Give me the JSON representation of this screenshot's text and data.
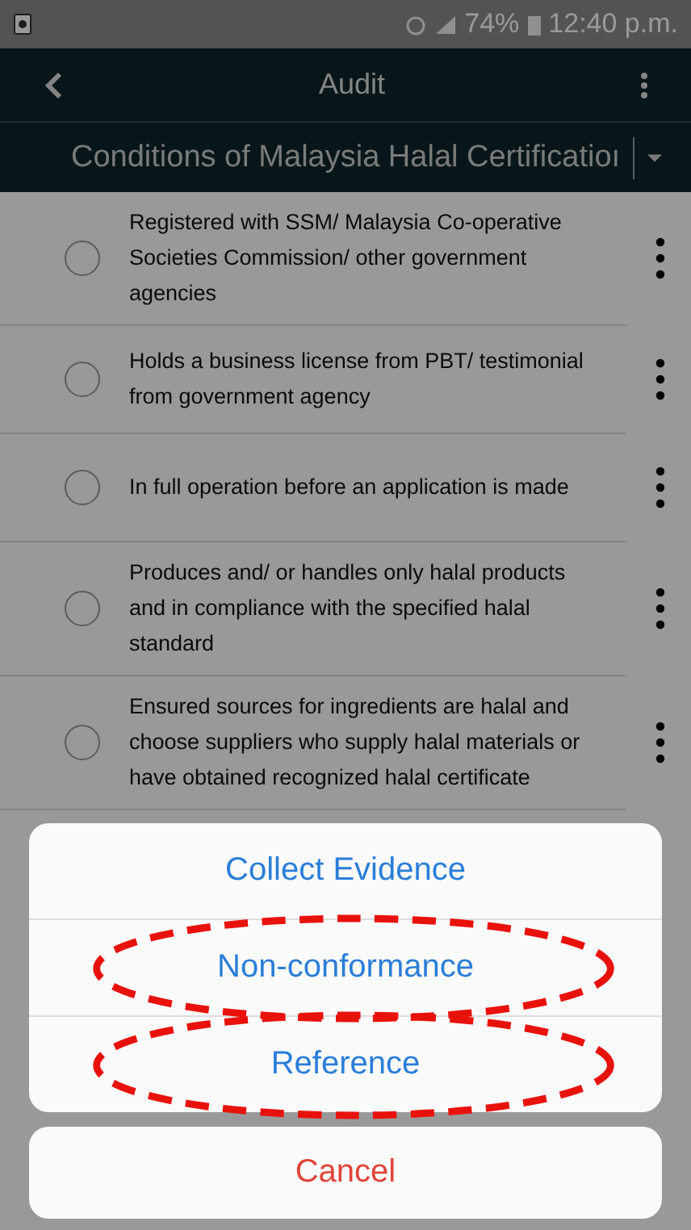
{
  "status_bar": {
    "battery": "74%",
    "time": "12:40 p.m."
  },
  "header": {
    "title": "Audit",
    "section": "Conditions of Malaysia Halal Certificatioı"
  },
  "items": [
    {
      "text": "Registered with SSM/ Malaysia Co-operative Societies Commission/ other government agencies",
      "checked": false
    },
    {
      "text": "Holds a business license from PBT/ testimonial from government agency",
      "checked": false
    },
    {
      "text": "In full operation before an application is made",
      "checked": false
    },
    {
      "text": "Produces and/ or handles only halal products and in compliance with the specified halal standard",
      "checked": false
    },
    {
      "text": "Ensured sources for ingredients are halal and choose suppliers who supply halal materials or have obtained recognized halal certificate",
      "checked": false
    }
  ],
  "action_sheet": {
    "actions": [
      {
        "label": "Collect Evidence",
        "highlighted": false
      },
      {
        "label": "Non-conformance",
        "highlighted": true
      },
      {
        "label": "Reference",
        "highlighted": true
      }
    ],
    "cancel": "Cancel"
  }
}
